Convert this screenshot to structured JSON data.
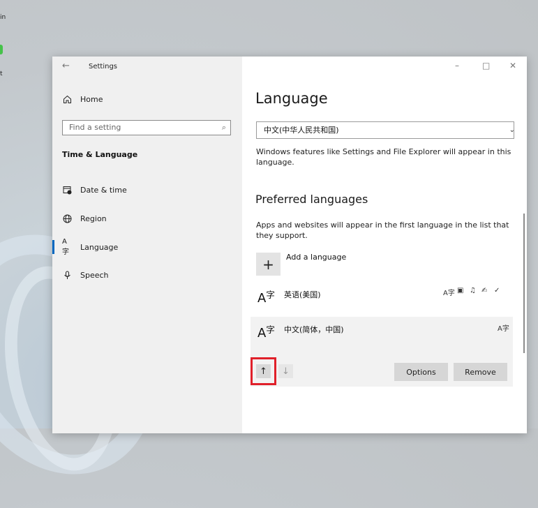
{
  "desktop": {
    "label1": "in",
    "label2": "t"
  },
  "window": {
    "back_icon": "back-arrow-icon",
    "title": "Settings",
    "controls": {
      "minimize": "–",
      "maximize": "□",
      "close": "✕"
    }
  },
  "sidebar": {
    "home_label": "Home",
    "search_placeholder": "Find a setting",
    "section_title": "Time & Language",
    "items": [
      {
        "label": "Date & time",
        "icon": "calendar-clock-icon"
      },
      {
        "label": "Region",
        "icon": "globe-icon"
      },
      {
        "label": "Language",
        "icon": "language-icon",
        "active": true
      },
      {
        "label": "Speech",
        "icon": "microphone-icon"
      }
    ]
  },
  "main": {
    "title": "Language",
    "display_language": "中文(中华人民共和国)",
    "display_desc": "Windows features like Settings and File Explorer will appear in this language.",
    "preferred_title": "Preferred languages",
    "preferred_desc": "Apps and websites will appear in the first language in the list that they support.",
    "add_language_label": "Add a language",
    "languages": [
      {
        "name": "英语(美国)",
        "features": [
          "display-language-icon",
          "text-to-speech-icon",
          "speech-icon",
          "handwriting-icon",
          "spell-check-icon"
        ]
      },
      {
        "name": "中文(简体，中国)",
        "features": [
          "display-language-icon"
        ],
        "selected": true
      }
    ],
    "options_label": "Options",
    "remove_label": "Remove"
  }
}
